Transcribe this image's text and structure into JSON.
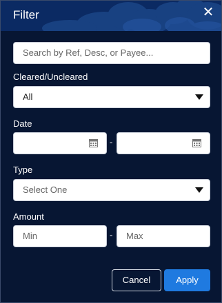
{
  "dialog": {
    "title": "Filter",
    "close_glyph": "✕"
  },
  "search": {
    "placeholder": "Search by Ref, Desc, or Payee..."
  },
  "cleared": {
    "label": "Cleared/Uncleared",
    "selected": "All"
  },
  "date": {
    "label": "Date",
    "separator": "-",
    "from_value": "",
    "to_value": ""
  },
  "type": {
    "label": "Type",
    "selected": "Select One"
  },
  "amount": {
    "label": "Amount",
    "min_placeholder": "Min",
    "max_placeholder": "Max",
    "separator": "-"
  },
  "buttons": {
    "cancel": "Cancel",
    "apply": "Apply"
  },
  "icons": {
    "date_from": "calendar-icon",
    "date_to": "calendar-icon",
    "dropdown": "chevron-down-icon",
    "close": "close-icon"
  },
  "colors": {
    "background": "#071633",
    "header": "#0b2a63",
    "apply": "#1f7ae0",
    "text": "#ffffff"
  }
}
